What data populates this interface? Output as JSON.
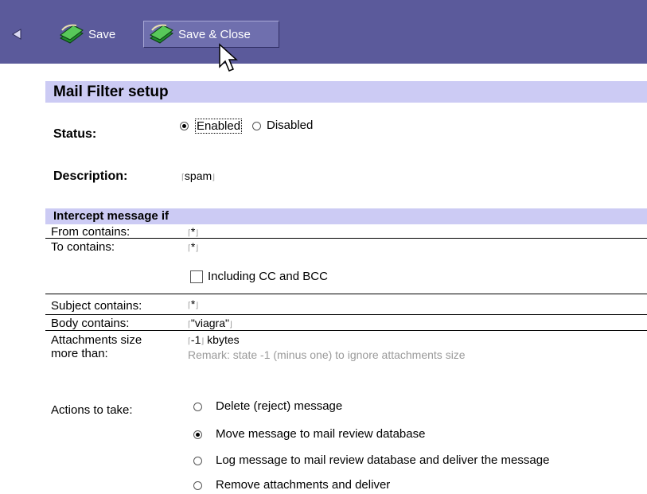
{
  "toolbar": {
    "back_icon": "left-arrow-icon",
    "save_label": "Save",
    "save_close_label": "Save & Close",
    "save_icon": "save-icon"
  },
  "form": {
    "title": "Mail Filter setup",
    "status": {
      "label": "Status:",
      "options": [
        "Enabled",
        "Disabled"
      ],
      "selected": "Enabled"
    },
    "description": {
      "label": "Description:",
      "value": "spam"
    },
    "intercept": {
      "header": "Intercept message if",
      "from_label": "From contains:",
      "from_value": "*",
      "to_label": "To contains:",
      "to_value": "*",
      "include_cc_label": "Including CC and BCC",
      "include_cc_checked": false,
      "subject_label": "Subject contains:",
      "subject_value": "*",
      "body_label": "Body contains:",
      "body_value": "\"viagra\"",
      "attach_label_1": "Attachments size",
      "attach_label_2": "more than:",
      "attach_value": "-1",
      "attach_unit": "kbytes",
      "attach_remark": "Remark: state -1 (minus one) to ignore attachments size"
    },
    "actions": {
      "label": "Actions to take:",
      "options": [
        "Delete (reject) message",
        "Move message to mail review database",
        "Log message to mail review database and deliver the message",
        "Remove attachments and deliver"
      ],
      "selected_index": 1
    }
  }
}
